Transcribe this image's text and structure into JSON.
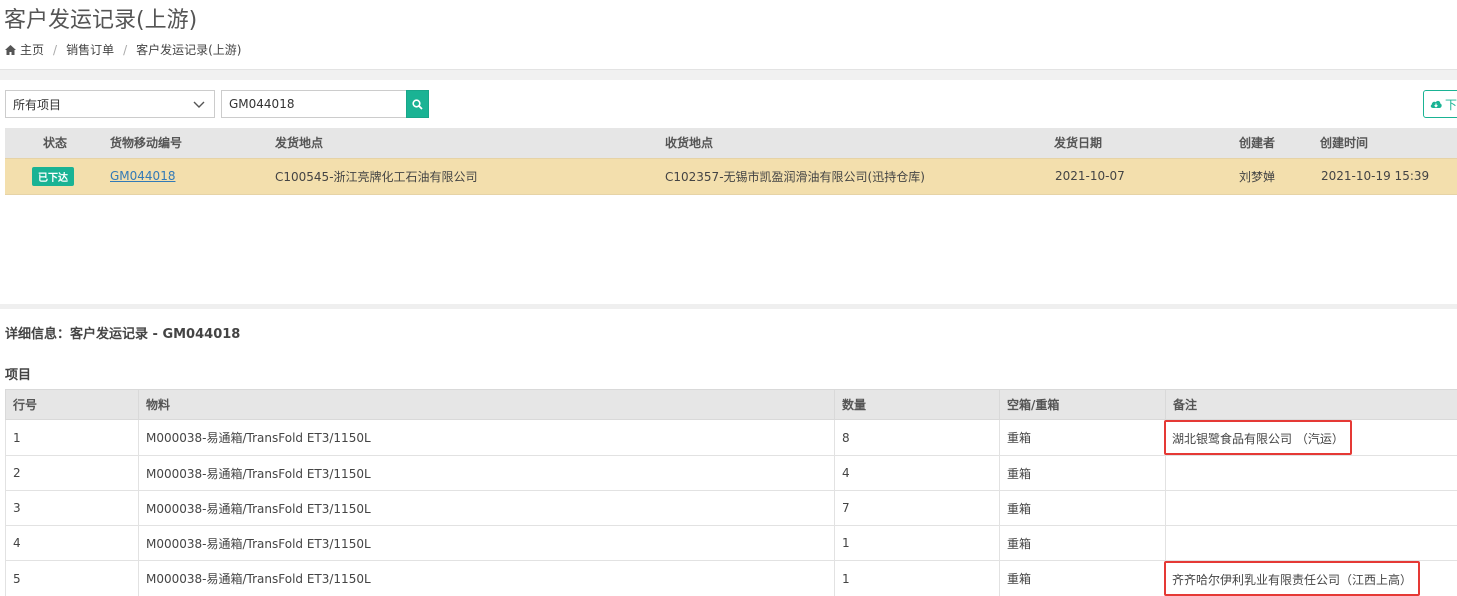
{
  "page": {
    "title": "客户发运记录(上游)"
  },
  "breadcrumb": {
    "items": [
      "主页",
      "销售订单",
      "客户发运记录(上游)"
    ]
  },
  "filters": {
    "project_select": "所有项目",
    "search_value": "GM044018",
    "download_label": "下"
  },
  "shipments": {
    "headers": [
      "状态",
      "货物移动编号",
      "发货地点",
      "收货地点",
      "发货日期",
      "创建者",
      "创建时间"
    ],
    "rows": [
      {
        "status": "已下达",
        "move_no": "GM044018",
        "from": "C100545-浙江亮牌化工石油有限公司",
        "to": "C102357-无锡市凯盈润滑油有限公司(迅持仓库)",
        "ship_date": "2021-10-07",
        "creator": "刘梦婵",
        "created_at": "2021-10-19 15:39"
      }
    ]
  },
  "detail": {
    "title": "详细信息：客户发运记录 - GM044018",
    "items_title": "项目"
  },
  "items": {
    "headers": [
      "行号",
      "物料",
      "数量",
      "空箱/重箱",
      "备注"
    ],
    "rows": [
      {
        "line": "1",
        "material": "M000038-易通箱/TransFold ET3/1150L",
        "qty": "8",
        "box": "重箱",
        "remark": "湖北银鹭食品有限公司 （汽运）"
      },
      {
        "line": "2",
        "material": "M000038-易通箱/TransFold ET3/1150L",
        "qty": "4",
        "box": "重箱",
        "remark": ""
      },
      {
        "line": "3",
        "material": "M000038-易通箱/TransFold ET3/1150L",
        "qty": "7",
        "box": "重箱",
        "remark": ""
      },
      {
        "line": "4",
        "material": "M000038-易通箱/TransFold ET3/1150L",
        "qty": "1",
        "box": "重箱",
        "remark": ""
      },
      {
        "line": "5",
        "material": "M000038-易通箱/TransFold ET3/1150L",
        "qty": "1",
        "box": "重箱",
        "remark": "齐齐哈尔伊利乳业有限责任公司（江西上高）"
      }
    ]
  },
  "colors": {
    "accent": "#1ab394",
    "selected_row": "#f3dfad",
    "highlight_border": "#e53935",
    "link": "#337ab7"
  }
}
